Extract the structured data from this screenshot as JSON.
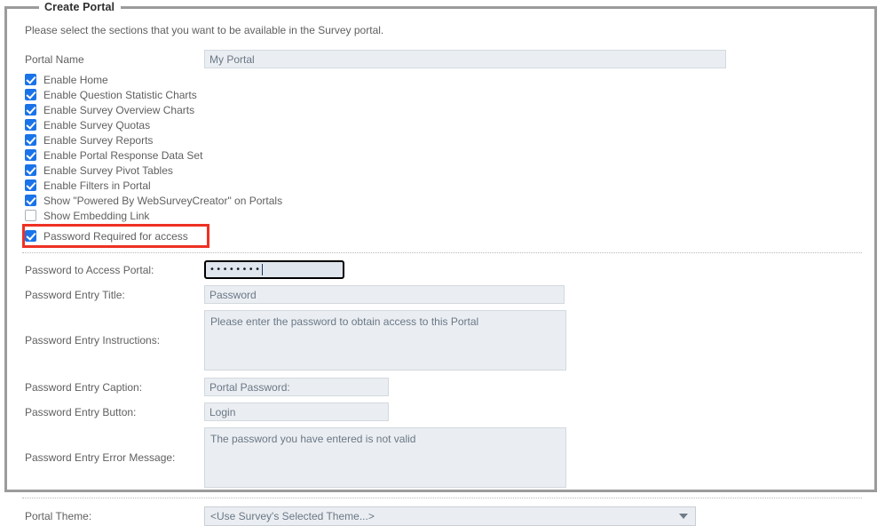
{
  "panel": {
    "legend": "Create Portal",
    "intro": "Please select the sections that you want to be available in the Survey portal."
  },
  "portal_name": {
    "label": "Portal Name",
    "value": "My Portal"
  },
  "checkboxes": [
    {
      "label": "Enable Home",
      "checked": true
    },
    {
      "label": "Enable Question Statistic Charts",
      "checked": true
    },
    {
      "label": "Enable Survey Overview Charts",
      "checked": true
    },
    {
      "label": "Enable Survey Quotas",
      "checked": true
    },
    {
      "label": "Enable Survey Reports",
      "checked": true
    },
    {
      "label": "Enable Portal Response Data Set",
      "checked": true
    },
    {
      "label": "Enable Survey Pivot Tables",
      "checked": true
    },
    {
      "label": "Enable Filters in Portal",
      "checked": true
    },
    {
      "label": "Show \"Powered By WebSurveyCreator\" on Portals",
      "checked": true
    },
    {
      "label": "Show Embedding Link",
      "checked": false
    },
    {
      "label": "Password Required for access",
      "checked": true
    }
  ],
  "highlight": {
    "target_label": "Password Required for access",
    "color": "#ee3124"
  },
  "password_section": {
    "access_password": {
      "label": "Password to Access Portal:",
      "masked_value": "••••••••",
      "char_count": 8,
      "focused": true
    },
    "entry_title": {
      "label": "Password Entry Title:",
      "value": "Password"
    },
    "entry_instructions": {
      "label": "Password Entry Instructions:",
      "value": "Please enter the password to obtain access to this Portal"
    },
    "entry_caption": {
      "label": "Password Entry Caption:",
      "value": "Portal Password:"
    },
    "entry_button": {
      "label": "Password Entry Button:",
      "value": "Login"
    },
    "entry_error": {
      "label": "Password Entry Error Message:",
      "value": "The password you have entered is not valid"
    }
  },
  "portal_theme": {
    "label": "Portal Theme:",
    "selected": "<Use Survey's Selected Theme...>",
    "chevron": "chevron-down-icon"
  },
  "colors": {
    "frame": "#9b9b9b",
    "input_bg": "#eaeef2",
    "checkbox_on": "#1a73e8",
    "highlight": "#ee3124",
    "text": "#5f5f5f"
  }
}
